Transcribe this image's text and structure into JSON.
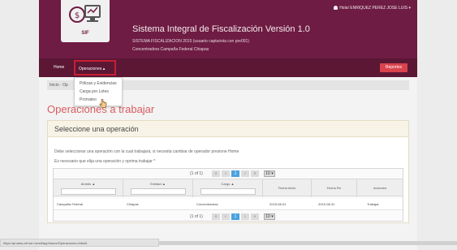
{
  "header": {
    "logo_text": "SIF",
    "title": "Sistema Integral de Fiscalización Versión 1.0",
    "subtitle1": "SISTEMA FISCALIZACION 2015 (usuario capturista con pre001)",
    "subtitle2": "Concentradora Campaña Federal Chiapas",
    "user": "Hola! ENRIQUEZ PEREZ JOSE LUIS ▾"
  },
  "nav": {
    "home": "Home",
    "operaciones": "Operaciones ▴",
    "salir": "Reportes"
  },
  "dropdown": {
    "items": [
      "Pólizas y Evidencias",
      "Carga por Lotes",
      "Prorrateo"
    ]
  },
  "breadcrumb": "Inicio  ·  Op",
  "heading": "Operaciones a trabajar",
  "panel": {
    "title": "Seleccione una operación",
    "instr1": "Debe seleccionar una operación con la cual trabajará, si necesita cambiar de operador presione Home",
    "instr2": "Es necesario que elija una operación y oprima trabajar *"
  },
  "grid": {
    "pager_count": "(1 of 1)",
    "pager_current": "1",
    "pager_size": "10 ▾",
    "headers": [
      "Ámbito ▲",
      "Entidad ▲",
      "Cargo ▲",
      "Fecha Inicio",
      "Fecha Fin",
      "Acciones"
    ],
    "row": [
      "Campaña Federal",
      "Chiapas",
      "Concentradora",
      "2015-08-01",
      "2015-08-31",
      "Trabajar"
    ]
  },
  "status_url": "https://prueba-sif.ine.mx/sif/app/home/Operaciones.xhtml#"
}
